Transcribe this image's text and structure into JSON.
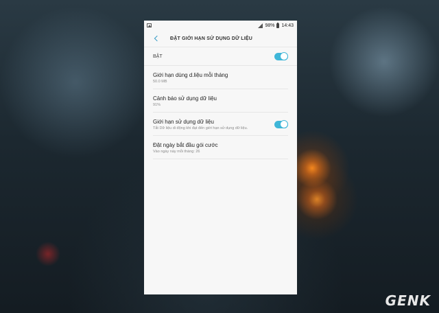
{
  "status_bar": {
    "battery_percent": "98%",
    "time": "14:43"
  },
  "app_bar": {
    "title": "ĐẶT GIỚI HẠN SỬ DỤNG DỮ LIỆU"
  },
  "master_switch": {
    "label": "BẬT",
    "enabled": true
  },
  "settings": [
    {
      "title": "Giới hạn dùng d.liệu mỗi tháng",
      "subtitle": "50.0 MB"
    },
    {
      "title": "Cảnh báo sử dụng dữ liệu",
      "subtitle": "91%"
    },
    {
      "title": "Giới hạn sử dụng dữ liệu",
      "subtitle": "Tắt Dữ liệu di động khi đạt đến giới hạn sử dụng dữ liệu.",
      "toggle": true
    },
    {
      "title": "Đặt ngày bắt đầu gói cước",
      "subtitle": "Vào ngày này mỗi tháng: 26"
    }
  ],
  "watermark": "GENK",
  "colors": {
    "accent": "#3fb6d8",
    "background": "#f7f7f7"
  }
}
